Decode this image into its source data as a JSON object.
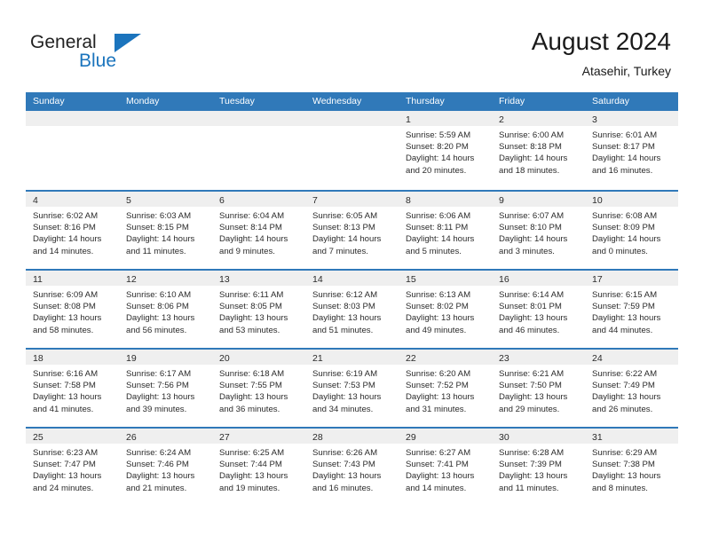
{
  "brand": {
    "name_part1": "General",
    "name_part2": "Blue",
    "flag_icon": "triangle-flag-icon",
    "accent_color": "#1b74bd"
  },
  "header": {
    "month_title": "August 2024",
    "location": "Atasehir, Turkey"
  },
  "calendar": {
    "header_background": "#3079b9",
    "day_band_background": "#efefef",
    "weekdays": [
      "Sunday",
      "Monday",
      "Tuesday",
      "Wednesday",
      "Thursday",
      "Friday",
      "Saturday"
    ],
    "weeks": [
      [
        {
          "day": "",
          "lines": []
        },
        {
          "day": "",
          "lines": []
        },
        {
          "day": "",
          "lines": []
        },
        {
          "day": "",
          "lines": []
        },
        {
          "day": "1",
          "lines": [
            "Sunrise: 5:59 AM",
            "Sunset: 8:20 PM",
            "Daylight: 14 hours",
            "and 20 minutes."
          ]
        },
        {
          "day": "2",
          "lines": [
            "Sunrise: 6:00 AM",
            "Sunset: 8:18 PM",
            "Daylight: 14 hours",
            "and 18 minutes."
          ]
        },
        {
          "day": "3",
          "lines": [
            "Sunrise: 6:01 AM",
            "Sunset: 8:17 PM",
            "Daylight: 14 hours",
            "and 16 minutes."
          ]
        }
      ],
      [
        {
          "day": "4",
          "lines": [
            "Sunrise: 6:02 AM",
            "Sunset: 8:16 PM",
            "Daylight: 14 hours",
            "and 14 minutes."
          ]
        },
        {
          "day": "5",
          "lines": [
            "Sunrise: 6:03 AM",
            "Sunset: 8:15 PM",
            "Daylight: 14 hours",
            "and 11 minutes."
          ]
        },
        {
          "day": "6",
          "lines": [
            "Sunrise: 6:04 AM",
            "Sunset: 8:14 PM",
            "Daylight: 14 hours",
            "and 9 minutes."
          ]
        },
        {
          "day": "7",
          "lines": [
            "Sunrise: 6:05 AM",
            "Sunset: 8:13 PM",
            "Daylight: 14 hours",
            "and 7 minutes."
          ]
        },
        {
          "day": "8",
          "lines": [
            "Sunrise: 6:06 AM",
            "Sunset: 8:11 PM",
            "Daylight: 14 hours",
            "and 5 minutes."
          ]
        },
        {
          "day": "9",
          "lines": [
            "Sunrise: 6:07 AM",
            "Sunset: 8:10 PM",
            "Daylight: 14 hours",
            "and 3 minutes."
          ]
        },
        {
          "day": "10",
          "lines": [
            "Sunrise: 6:08 AM",
            "Sunset: 8:09 PM",
            "Daylight: 14 hours",
            "and 0 minutes."
          ]
        }
      ],
      [
        {
          "day": "11",
          "lines": [
            "Sunrise: 6:09 AM",
            "Sunset: 8:08 PM",
            "Daylight: 13 hours",
            "and 58 minutes."
          ]
        },
        {
          "day": "12",
          "lines": [
            "Sunrise: 6:10 AM",
            "Sunset: 8:06 PM",
            "Daylight: 13 hours",
            "and 56 minutes."
          ]
        },
        {
          "day": "13",
          "lines": [
            "Sunrise: 6:11 AM",
            "Sunset: 8:05 PM",
            "Daylight: 13 hours",
            "and 53 minutes."
          ]
        },
        {
          "day": "14",
          "lines": [
            "Sunrise: 6:12 AM",
            "Sunset: 8:03 PM",
            "Daylight: 13 hours",
            "and 51 minutes."
          ]
        },
        {
          "day": "15",
          "lines": [
            "Sunrise: 6:13 AM",
            "Sunset: 8:02 PM",
            "Daylight: 13 hours",
            "and 49 minutes."
          ]
        },
        {
          "day": "16",
          "lines": [
            "Sunrise: 6:14 AM",
            "Sunset: 8:01 PM",
            "Daylight: 13 hours",
            "and 46 minutes."
          ]
        },
        {
          "day": "17",
          "lines": [
            "Sunrise: 6:15 AM",
            "Sunset: 7:59 PM",
            "Daylight: 13 hours",
            "and 44 minutes."
          ]
        }
      ],
      [
        {
          "day": "18",
          "lines": [
            "Sunrise: 6:16 AM",
            "Sunset: 7:58 PM",
            "Daylight: 13 hours",
            "and 41 minutes."
          ]
        },
        {
          "day": "19",
          "lines": [
            "Sunrise: 6:17 AM",
            "Sunset: 7:56 PM",
            "Daylight: 13 hours",
            "and 39 minutes."
          ]
        },
        {
          "day": "20",
          "lines": [
            "Sunrise: 6:18 AM",
            "Sunset: 7:55 PM",
            "Daylight: 13 hours",
            "and 36 minutes."
          ]
        },
        {
          "day": "21",
          "lines": [
            "Sunrise: 6:19 AM",
            "Sunset: 7:53 PM",
            "Daylight: 13 hours",
            "and 34 minutes."
          ]
        },
        {
          "day": "22",
          "lines": [
            "Sunrise: 6:20 AM",
            "Sunset: 7:52 PM",
            "Daylight: 13 hours",
            "and 31 minutes."
          ]
        },
        {
          "day": "23",
          "lines": [
            "Sunrise: 6:21 AM",
            "Sunset: 7:50 PM",
            "Daylight: 13 hours",
            "and 29 minutes."
          ]
        },
        {
          "day": "24",
          "lines": [
            "Sunrise: 6:22 AM",
            "Sunset: 7:49 PM",
            "Daylight: 13 hours",
            "and 26 minutes."
          ]
        }
      ],
      [
        {
          "day": "25",
          "lines": [
            "Sunrise: 6:23 AM",
            "Sunset: 7:47 PM",
            "Daylight: 13 hours",
            "and 24 minutes."
          ]
        },
        {
          "day": "26",
          "lines": [
            "Sunrise: 6:24 AM",
            "Sunset: 7:46 PM",
            "Daylight: 13 hours",
            "and 21 minutes."
          ]
        },
        {
          "day": "27",
          "lines": [
            "Sunrise: 6:25 AM",
            "Sunset: 7:44 PM",
            "Daylight: 13 hours",
            "and 19 minutes."
          ]
        },
        {
          "day": "28",
          "lines": [
            "Sunrise: 6:26 AM",
            "Sunset: 7:43 PM",
            "Daylight: 13 hours",
            "and 16 minutes."
          ]
        },
        {
          "day": "29",
          "lines": [
            "Sunrise: 6:27 AM",
            "Sunset: 7:41 PM",
            "Daylight: 13 hours",
            "and 14 minutes."
          ]
        },
        {
          "day": "30",
          "lines": [
            "Sunrise: 6:28 AM",
            "Sunset: 7:39 PM",
            "Daylight: 13 hours",
            "and 11 minutes."
          ]
        },
        {
          "day": "31",
          "lines": [
            "Sunrise: 6:29 AM",
            "Sunset: 7:38 PM",
            "Daylight: 13 hours",
            "and 8 minutes."
          ]
        }
      ]
    ]
  }
}
